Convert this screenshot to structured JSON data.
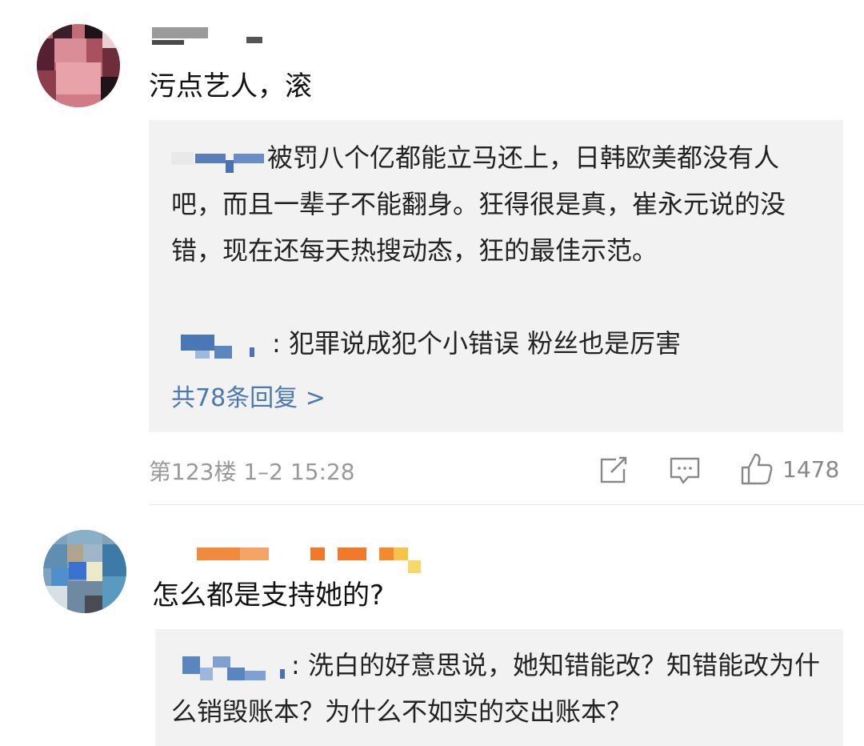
{
  "comments": [
    {
      "text": "污点艺人，滚",
      "replies": [
        {
          "text": "被罚八个亿都能立马还上，日韩欧美都没有人吧，而且一辈子不能翻身。狂得很是真，崔永元说的没错，现在还每天热搜动态，狂的最佳示范。"
        },
        {
          "text": ": 犯罪说成犯个小错误  粉丝也是厉害"
        }
      ],
      "more_replies": "共78条回复 >",
      "floor_time": "第123楼 1–2 15:28",
      "like_count": "1478"
    },
    {
      "text": "怎么都是支持她的?",
      "replies": [
        {
          "text": ": 洗白的好意思说，她知错能改？知错能改为什么销毁账本？为什么不如实的交出账本？"
        }
      ]
    }
  ],
  "icons": {
    "share": "share-icon",
    "comment": "comment-icon",
    "like": "thumbs-up-icon"
  }
}
